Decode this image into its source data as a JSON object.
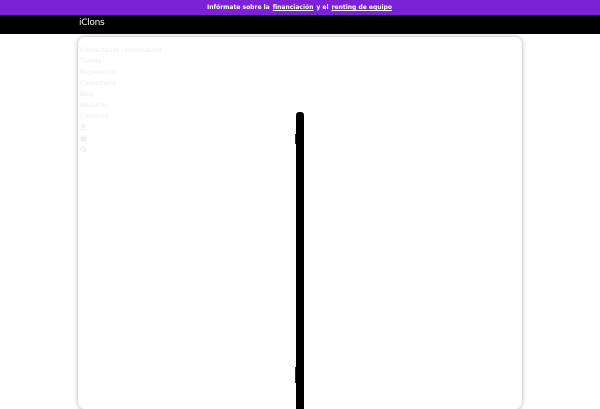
{
  "promo": {
    "text_1": "Infórmate sobre la",
    "link_1": "financiación",
    "text_2": "y el",
    "link_2": "renting de equipo"
  },
  "header": {
    "logo": "iClons"
  },
  "menu": {
    "items": [
      {
        "label": "Contáctanos (Informacion"
      },
      {
        "label": "Tienda"
      },
      {
        "label": "Reparación"
      },
      {
        "label": "Consultoría"
      },
      {
        "label": "Blog"
      },
      {
        "label": "Nosotros"
      },
      {
        "label": "Contacto"
      }
    ],
    "icons": [
      "user-icon",
      "cart-icon",
      "search-icon"
    ]
  },
  "colors": {
    "promo_bg": "#7b22d8",
    "header_bg": "#000000",
    "menu_text": "#ececec"
  }
}
